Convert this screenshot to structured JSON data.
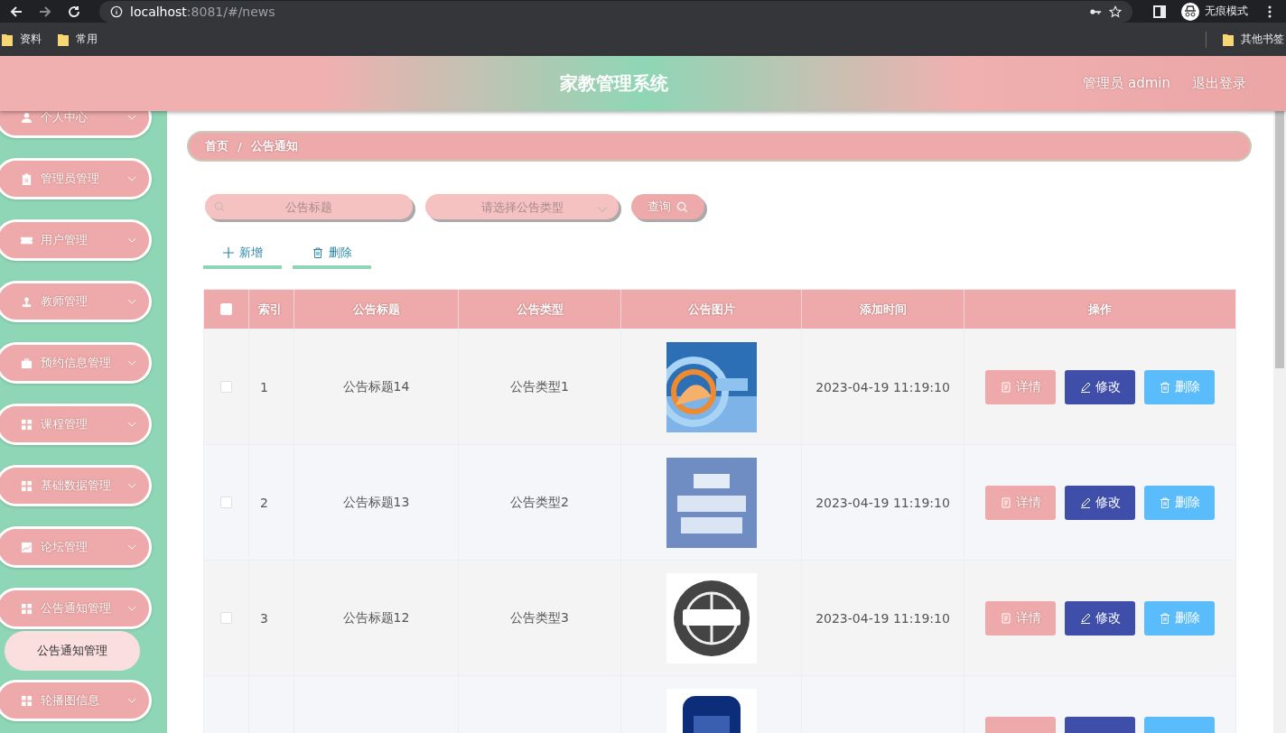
{
  "browser": {
    "url_host": "localhost",
    "url_rest": ":8081/#/news",
    "profile": "无痕模式",
    "bookmarks": [
      {
        "label": "资料"
      },
      {
        "label": "常用"
      }
    ],
    "other_bookmarks": "其他书签"
  },
  "header": {
    "title": "家教管理系统",
    "user": "管理员 admin",
    "logout": "退出登录"
  },
  "sidebar": {
    "items": [
      {
        "label": "个人中心",
        "kind": "person",
        "expanded": false
      },
      {
        "label": "管理员管理",
        "kind": "clipboard",
        "expanded": false
      },
      {
        "label": "用户管理",
        "kind": "ticket",
        "expanded": false
      },
      {
        "label": "教师管理",
        "kind": "stamp",
        "expanded": false
      },
      {
        "label": "预约信息管理",
        "kind": "briefcase",
        "expanded": false
      },
      {
        "label": "课程管理",
        "kind": "grid",
        "expanded": false
      },
      {
        "label": "基础数据管理",
        "kind": "grid",
        "expanded": false
      },
      {
        "label": "论坛管理",
        "kind": "chart",
        "expanded": false
      },
      {
        "label": "公告通知管理",
        "kind": "grid",
        "expanded": true,
        "children": [
          {
            "label": "公告通知管理",
            "selected": true
          }
        ]
      },
      {
        "label": "轮播图信息",
        "kind": "grid",
        "expanded": false
      }
    ]
  },
  "breadcrumb": {
    "items": [
      "首页",
      "公告通知"
    ],
    "separator": "/"
  },
  "search": {
    "title_placeholder": "公告标题",
    "type_placeholder": "请选择公告类型",
    "query": "查询"
  },
  "actions": {
    "add": "新增",
    "delete": "删除"
  },
  "table": {
    "header_checked": false,
    "columns": [
      "索引",
      "公告标题",
      "公告类型",
      "公告图片",
      "添加时间",
      "操作"
    ],
    "rows": [
      {
        "kind": "full",
        "checked": false,
        "index": "1",
        "title": "公告标题14",
        "type": "公告类型1",
        "time": "2023-04-19 11:19:10",
        "buttons": [
          "详情",
          "修改",
          "删除"
        ]
      },
      {
        "kind": "full",
        "checked": false,
        "index": "2",
        "title": "公告标题13",
        "type": "公告类型2",
        "time": "2023-04-19 11:19:10",
        "buttons": [
          "详情",
          "修改",
          "删除"
        ]
      },
      {
        "kind": "full",
        "checked": false,
        "index": "3",
        "title": "公告标题12",
        "type": "公告类型3",
        "time": "2023-04-19 11:19:10",
        "buttons": [
          "详情",
          "修改",
          "删除"
        ]
      },
      {
        "kind": "cut"
      }
    ]
  }
}
